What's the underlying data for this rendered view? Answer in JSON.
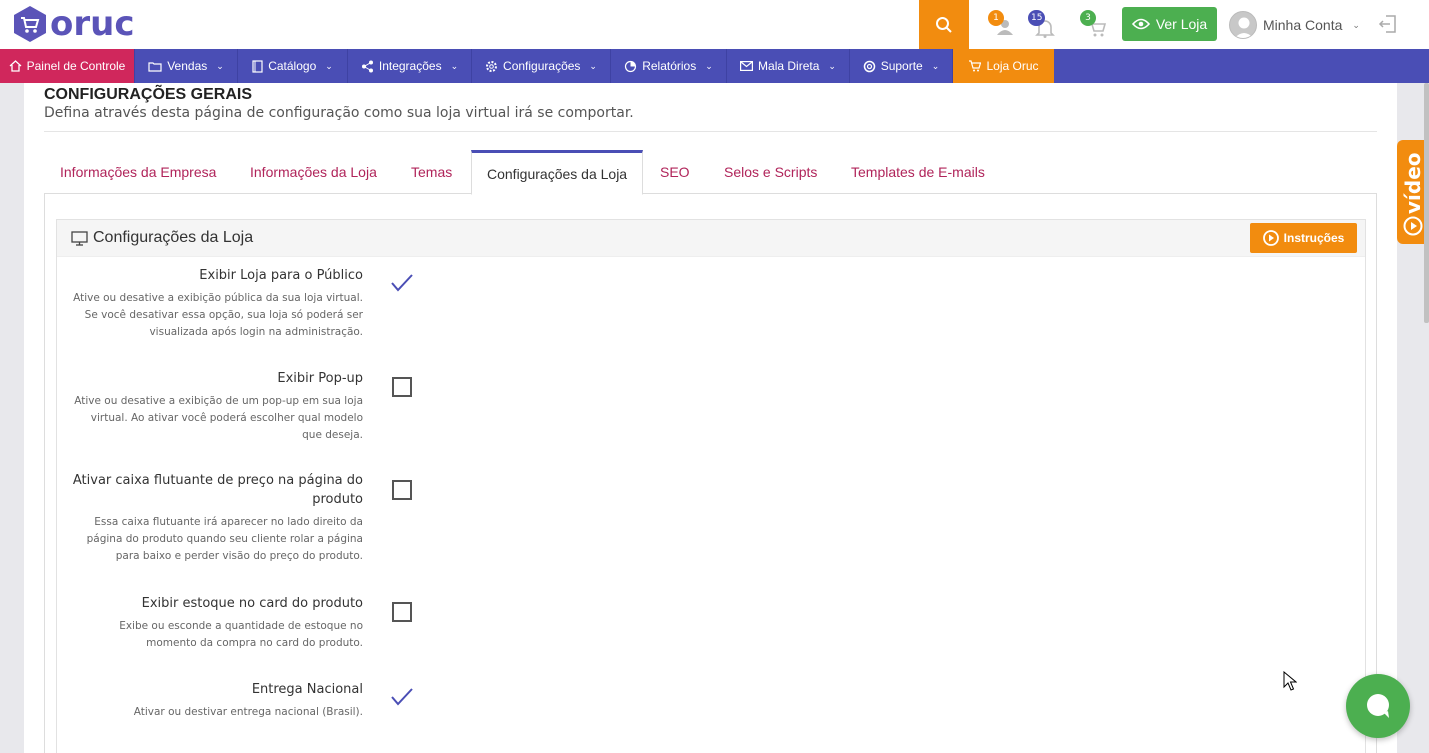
{
  "header": {
    "logo_text": "oruc",
    "badges": {
      "users": "1",
      "bell": "15",
      "cart": "3"
    },
    "ver_loja_label": "Ver Loja",
    "account_label": "Minha Conta"
  },
  "nav": {
    "items": [
      {
        "label": "Painel de Controle"
      },
      {
        "label": "Vendas"
      },
      {
        "label": "Catálogo"
      },
      {
        "label": "Integrações"
      },
      {
        "label": "Configurações"
      },
      {
        "label": "Relatórios"
      },
      {
        "label": "Mala Direta"
      },
      {
        "label": "Suporte"
      },
      {
        "label": "Loja Oruc"
      }
    ]
  },
  "page": {
    "title": "CONFIGURAÇÕES GERAIS",
    "subtitle": "Defina através desta página de configuração como sua loja virtual irá se comportar."
  },
  "tabs": [
    {
      "label": "Informações da Empresa"
    },
    {
      "label": "Informações da Loja"
    },
    {
      "label": "Temas"
    },
    {
      "label": "Configurações da Loja",
      "active": true
    },
    {
      "label": "SEO"
    },
    {
      "label": "Selos e Scripts"
    },
    {
      "label": "Templates de E-mails"
    }
  ],
  "card": {
    "title": "Configurações da Loja",
    "instructions_label": "Instruções"
  },
  "settings": [
    {
      "label": "Exibir Loja para o Público",
      "desc_lines": [
        "Ative ou desative a exibição pública da sua loja virtual.",
        "Se você desativar essa opção, sua loja só poderá ser",
        "visualizada após login na administração."
      ],
      "checked": true
    },
    {
      "label": "Exibir Pop-up",
      "desc_lines": [
        "Ative ou desative a exibição de um pop-up em sua loja",
        "virtual. Ao ativar você poderá escolher qual modelo",
        "que deseja."
      ],
      "checked": false
    },
    {
      "label_lines": [
        "Ativar caixa flutuante de preço na página do",
        "produto"
      ],
      "desc_lines": [
        "Essa caixa flutuante irá aparecer no lado direito da",
        "página do produto quando seu cliente rolar a página",
        "para baixo e perder visão do preço do produto."
      ],
      "checked": false
    },
    {
      "label": "Exibir estoque no card do produto",
      "desc_lines": [
        "Exibe ou esconde a quantidade de estoque no",
        "momento da compra no card do produto."
      ],
      "checked": false
    },
    {
      "label": "Entrega Nacional",
      "desc_lines": [
        "Ativar ou destivar entrega nacional (Brasil)."
      ],
      "checked": true
    }
  ],
  "video_tab_label": "vídeo",
  "colors": {
    "brand_purple": "#4a4eb5",
    "orange": "#f28c0f",
    "green": "#4caf50",
    "pink": "#d0275c"
  }
}
